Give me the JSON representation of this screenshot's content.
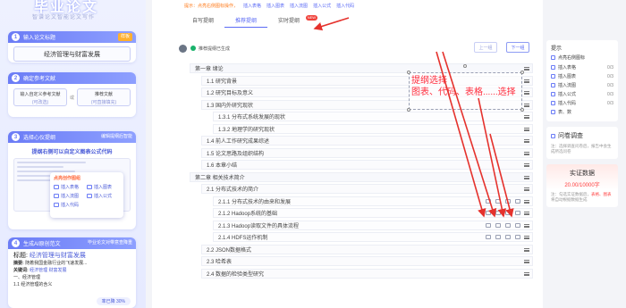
{
  "left": {
    "logo_title": "毕业论文",
    "logo_subtitle": "智谱论文智能论文写作",
    "step1": {
      "num": "1",
      "label": "输入论文标题",
      "tag": "样板",
      "title_value": "经济管理与财富发展"
    },
    "step2": {
      "num": "2",
      "label": "确定参考文献",
      "custom_ref": {
        "label": "输入自定义参考文献",
        "sub": "(可改选)"
      },
      "or_label": "或",
      "recommend_ref": {
        "label": "推荐文献",
        "sub": "(可直接填充)"
      }
    },
    "step3": {
      "num": "3",
      "label": "选择心仪提纲",
      "tag": "编辑提纲后智能",
      "desc": "提纲右侧可以自定义图表公式代码",
      "popup": {
        "title": "点亮创作图组",
        "items": [
          "插入表格",
          "插入图表",
          "插入流图",
          "插入公式",
          "插入代码"
        ]
      }
    },
    "step4": {
      "num": "4",
      "label": "生成AI原创范文",
      "tag": "毕业论文对带意查降重",
      "essay_title_label": "标题:",
      "essay_title_value": "经济管理与财富发展",
      "abstract_label": "摘要:",
      "abstract_text": "随着我国金融行业的飞速发展...",
      "keywords_label": "关键词:",
      "keywords_value": "经济管理 财富发展",
      "section_1": "一、经济管理",
      "section_1_1": "1.1 经济管理的含义",
      "progress_label": "率已降 30%"
    }
  },
  "main": {
    "notice_text": "提示：点亮右侧图标操作，",
    "notice_links": [
      "插入表格",
      "插入图表",
      "插入流图",
      "插入公式",
      "插入代码"
    ],
    "tabs": [
      {
        "label": "自写提纲"
      },
      {
        "label": "推荐提纲"
      },
      {
        "label": "实时提纲",
        "badge": "NEW"
      }
    ],
    "generated_label": "推荐提纲已生成",
    "prev_button": "上一组",
    "next_button": "下一组",
    "outline": [
      {
        "level": 1,
        "text": "第一章 绪论"
      },
      {
        "level": 2,
        "text": "1.1 研究背景"
      },
      {
        "level": 2,
        "text": "1.2 研究目标及意义"
      },
      {
        "level": 2,
        "text": "1.3 国内外研究现状"
      },
      {
        "level": 3,
        "text": "1.3.1 分布式系统发展的现状"
      },
      {
        "level": 3,
        "text": "1.3.2 地理学的研究现状"
      },
      {
        "level": 2,
        "text": "1.4 前人工作研究成果综述"
      },
      {
        "level": 2,
        "text": "1.5 论文思路及组织结构"
      },
      {
        "level": 2,
        "text": "1.6 本章小结"
      },
      {
        "level": 1,
        "text": "第二章 相关技术简介"
      },
      {
        "level": 2,
        "text": "2.1 分布式技术的简介"
      },
      {
        "level": 3,
        "text": "2.1.1 分布式技术的由来和发展"
      },
      {
        "level": 3,
        "text": "2.1.2 Hadoop系统的基础"
      },
      {
        "level": 3,
        "text": "2.1.3 Hadoop读取文件的具体流程"
      },
      {
        "level": 3,
        "text": "2.1.4 HDFS运作机制"
      },
      {
        "level": 2,
        "text": "2.2 JSON数据格式"
      },
      {
        "level": 2,
        "text": "2.3 哈希表"
      },
      {
        "level": 2,
        "text": "2.4 数据的检验类型研究"
      }
    ],
    "annotation": {
      "line1": "提纲选择",
      "line2": "图表、代码、表格......选择"
    }
  },
  "right": {
    "insert_card": {
      "title": "提示",
      "head": "点亮右侧图标",
      "items": [
        {
          "label": "插入表格",
          "count": "0/3"
        },
        {
          "label": "插入图表",
          "count": "0/3"
        },
        {
          "label": "插入流图",
          "count": "0/3"
        },
        {
          "label": "插入公式",
          "count": "0/3"
        },
        {
          "label": "插入代码",
          "count": "0/3"
        },
        {
          "label": "表、数",
          "count": ""
        }
      ]
    },
    "survey": {
      "title": "问卷调查",
      "tip": "注：选择调查问卷后，报告中会生成所选问卷"
    },
    "real_data": {
      "title": "实证数据",
      "count": "20.00/10000字",
      "tip_pre": "注：勾选实证数据后，",
      "tip_red": "表格、图表",
      "tip_post": "将自动根据数据生成"
    }
  },
  "colors": {
    "accent": "#5b6bf5",
    "annotation": "#ff2d3d",
    "notice": "#ff7a1a",
    "arrow": "#e5322d"
  }
}
